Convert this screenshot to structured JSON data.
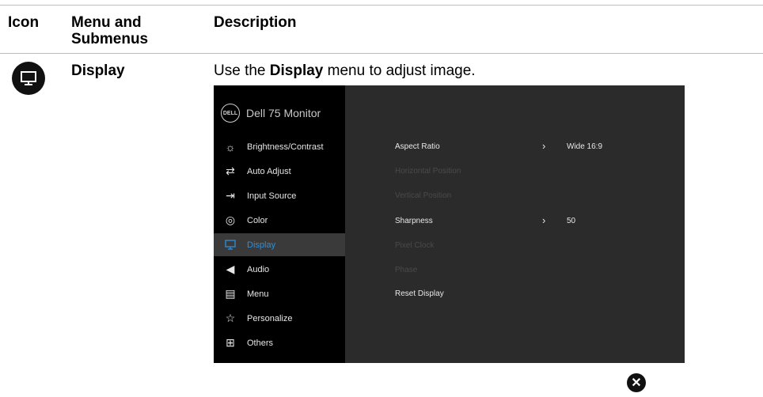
{
  "header": {
    "col_icon": "Icon",
    "col_menu": "Menu and Submenus",
    "col_desc": "Description"
  },
  "section": {
    "icon": "display-icon",
    "title": "Display",
    "desc_pre": "Use the ",
    "desc_bold": "Display",
    "desc_post": " menu to adjust image."
  },
  "osd": {
    "logo_text": "DELL",
    "brand": "Dell 75 Monitor",
    "menu": [
      {
        "label": "Brightness/Contrast",
        "icon": "brightness-icon",
        "active": false
      },
      {
        "label": "Auto Adjust",
        "icon": "auto-adjust-icon",
        "active": false
      },
      {
        "label": "Input Source",
        "icon": "input-source-icon",
        "active": false
      },
      {
        "label": "Color",
        "icon": "color-icon",
        "active": false
      },
      {
        "label": "Display",
        "icon": "display-icon",
        "active": true
      },
      {
        "label": "Audio",
        "icon": "audio-icon",
        "active": false
      },
      {
        "label": "Menu",
        "icon": "menu-icon",
        "active": false
      },
      {
        "label": "Personalize",
        "icon": "star-icon",
        "active": false
      },
      {
        "label": "Others",
        "icon": "others-icon",
        "active": false
      }
    ],
    "settings": [
      {
        "label": "Aspect Ratio",
        "enabled": true,
        "value": "Wide 16:9"
      },
      {
        "label": "Horizontal Position",
        "enabled": false,
        "value": ""
      },
      {
        "label": "Vertical Position",
        "enabled": false,
        "value": ""
      },
      {
        "label": "Sharpness",
        "enabled": true,
        "value": "50"
      },
      {
        "label": "Pixel Clock",
        "enabled": false,
        "value": ""
      },
      {
        "label": "Phase",
        "enabled": false,
        "value": ""
      },
      {
        "label": "Reset Display",
        "enabled": true,
        "value": ""
      }
    ],
    "chevron": "›",
    "accent_color": "#2f8fd8"
  },
  "close_icon": "close-icon"
}
